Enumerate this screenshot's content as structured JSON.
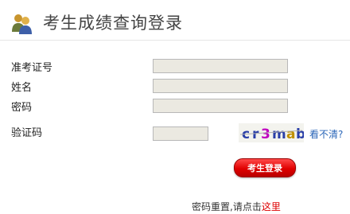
{
  "header": {
    "title": "考生成绩查询登录",
    "icon": "users-icon"
  },
  "form": {
    "id_label": "准考证号",
    "id_value": "",
    "name_label": "姓名",
    "name_value": "",
    "password_label": "密码",
    "password_value": "",
    "captcha_label": "验证码",
    "captcha_value": "",
    "captcha_text": "cr3mab",
    "refresh_link": "看不清?",
    "submit_label": "考生登录"
  },
  "footer": {
    "reset_text": "密码重置,请点击",
    "reset_link": "这里"
  },
  "colors": {
    "button_red": "#e00000",
    "link_blue": "#2a66b8",
    "input_bg": "#ebe9e1"
  }
}
